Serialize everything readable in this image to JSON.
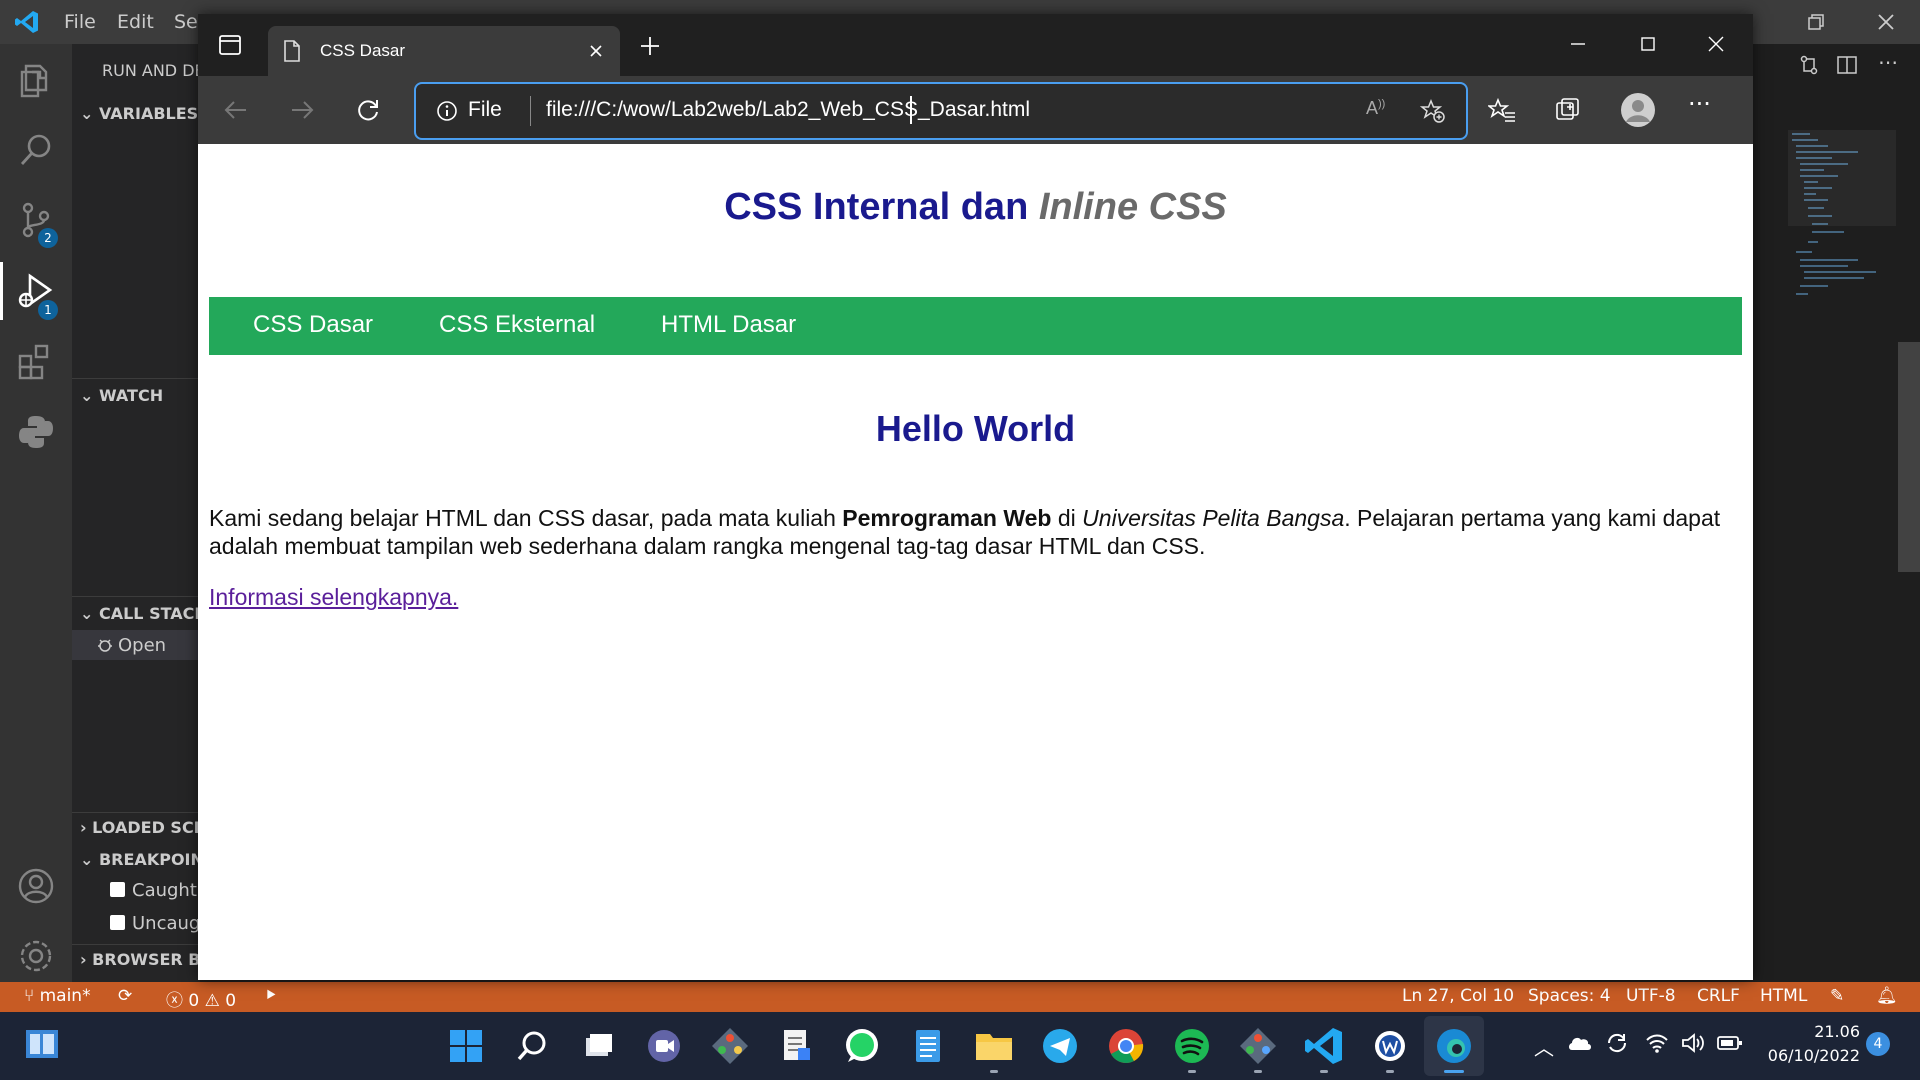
{
  "vscode": {
    "menu": [
      "File",
      "Edit",
      "Se"
    ],
    "sidebar": {
      "title": "RUN AND DE",
      "variables": "VARIABLES",
      "watch": "WATCH",
      "call_stack": "CALL STACK",
      "call_stack_item": "Open",
      "loaded_scripts": "LOADED SCI",
      "breakpoints": "BREAKPOIN",
      "bp_caught": "Caught",
      "bp_uncaught": "Uncaug",
      "browser_bp": "BROWSER B"
    },
    "badges": {
      "scm": "2",
      "debug": "1"
    }
  },
  "browser": {
    "tab_title": "CSS Dasar",
    "url_scheme_label": "File",
    "url": "file:///C:/wow/Lab2web/Lab2_Web_CSS_Dasar.html"
  },
  "page": {
    "title_main": "CSS Internal dan ",
    "title_em": "Inline CSS",
    "nav": [
      "CSS Dasar",
      "CSS Eksternal",
      "HTML Dasar"
    ],
    "heading": "Hello World",
    "para_1": "Kami sedang belajar HTML dan CSS dasar, pada mata kuliah ",
    "para_bold": "Pemrograman Web",
    "para_2": " di ",
    "para_em": "Universitas Pelita Bangsa",
    "para_3": ". Pelajaran pertama yang kami dapat adalah membuat tampilan web sederhana dalam rangka mengenal tag-tag dasar HTML dan CSS.",
    "link": "Informasi selengkapnya."
  },
  "status_bar": {
    "branch": "main*",
    "errors": "0",
    "warnings": "0",
    "position": "Ln 27, Col 10",
    "spaces": "Spaces: 4",
    "encoding": "UTF-8",
    "eol": "CRLF",
    "language": "HTML"
  },
  "taskbar": {
    "time": "21.06",
    "date": "06/10/2022",
    "notifications": "4"
  },
  "colors": {
    "status_bar": "#c75b24",
    "nav_bar": "#23a85a",
    "heading": "#1a1a8e",
    "accent": "#4a9ef0"
  }
}
